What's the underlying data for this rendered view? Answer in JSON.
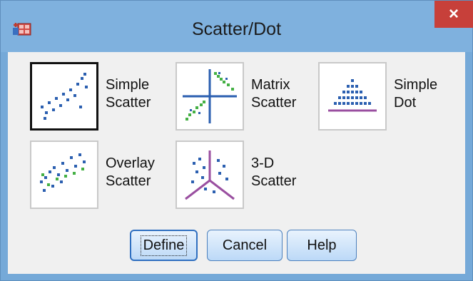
{
  "window": {
    "title": "Scatter/Dot",
    "close_glyph": "×",
    "app_icon": "spss-chart-icon"
  },
  "gallery": {
    "items": [
      {
        "id": "simple-scatter",
        "line1": "Simple",
        "line2": "Scatter",
        "icon": "simple-scatter-icon",
        "selected": true
      },
      {
        "id": "matrix-scatter",
        "line1": "Matrix",
        "line2": "Scatter",
        "icon": "matrix-scatter-icon",
        "selected": false
      },
      {
        "id": "simple-dot",
        "line1": "Simple",
        "line2": "Dot",
        "icon": "simple-dot-icon",
        "selected": false
      },
      {
        "id": "overlay-scatter",
        "line1": "Overlay",
        "line2": "Scatter",
        "icon": "overlay-scatter-icon",
        "selected": false
      },
      {
        "id": "3d-scatter",
        "line1": "3-D",
        "line2": "Scatter",
        "icon": "3d-scatter-icon",
        "selected": false
      }
    ]
  },
  "buttons": {
    "define": "Define",
    "cancel": "Cancel",
    "help": "Help"
  },
  "colors": {
    "titlebar": "#7fb1de",
    "close": "#c7403a",
    "dots": "#2b5fb0",
    "green": "#44b044",
    "purple": "#9a4fa0"
  }
}
